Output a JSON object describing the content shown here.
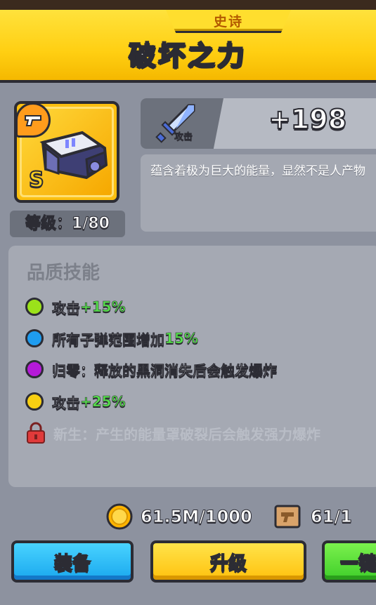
{
  "header": {
    "rarity": "史诗",
    "title": "破坏之力"
  },
  "item": {
    "grade": "S",
    "level_label": "等级：1/80"
  },
  "stat": {
    "label": "攻击",
    "value": "+198"
  },
  "description": "蕴含着极为巨大的能量，显然不是人产物",
  "skills": {
    "title": "品质技能",
    "items": [
      {
        "text": "攻击",
        "bonus": "+15%",
        "color": "#9be21a"
      },
      {
        "text": "所有子弹范围增加",
        "bonus": "15%",
        "color": "#1e9cf0"
      },
      {
        "text": "归零：释放的黑洞消失后会触发爆炸",
        "bonus": "",
        "color": "#b51ad8"
      },
      {
        "text": "攻击",
        "bonus": "+25%",
        "color": "#f8cf12"
      }
    ],
    "locked": {
      "text": "新生：产生的能量罩破裂后会触发强力爆炸"
    }
  },
  "resources": {
    "coins": "61.5M/1000",
    "blueprints": "61/1"
  },
  "buttons": {
    "equip": "装备",
    "upgrade": "升级",
    "one_click": "一键"
  },
  "colors": {
    "header_yellow": "#ffcf12",
    "equip_blue": "#1aa8ee",
    "upgrade_yellow": "#ffc20e",
    "green": "#3fcf2a",
    "bonus_green": "#55e04a"
  }
}
